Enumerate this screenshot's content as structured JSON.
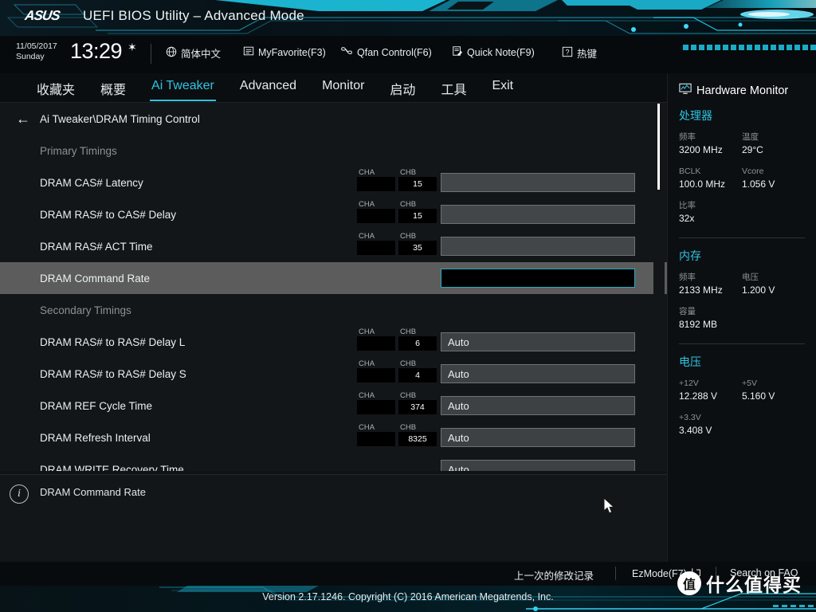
{
  "header": {
    "logo": "ASUS",
    "title": "UEFI BIOS Utility – Advanced Mode"
  },
  "infostrip": {
    "date": "11/05/2017",
    "weekday": "Sunday",
    "time": "13:29",
    "gear_icon": "gear-icon",
    "tools": [
      {
        "icon": "globe-icon",
        "label": "简体中文"
      },
      {
        "icon": "list-icon",
        "label": "MyFavorite(F3)"
      },
      {
        "icon": "fan-icon",
        "label": "Qfan Control(F6)"
      },
      {
        "icon": "note-icon",
        "label": "Quick Note(F9)"
      },
      {
        "icon": "question-icon",
        "label": "热键"
      }
    ]
  },
  "nav": {
    "tabs": [
      {
        "label": "收藏夹",
        "active": false
      },
      {
        "label": "概要",
        "active": false
      },
      {
        "label": "Ai Tweaker",
        "active": true
      },
      {
        "label": "Advanced",
        "active": false
      },
      {
        "label": "Monitor",
        "active": false
      },
      {
        "label": "启动",
        "active": false
      },
      {
        "label": "工具",
        "active": false
      },
      {
        "label": "Exit",
        "active": false
      }
    ]
  },
  "main": {
    "breadcrumb": "Ai Tweaker\\DRAM Timing Control",
    "back_icon": "back-arrow-icon",
    "ch_a_label": "CHA",
    "ch_b_label": "CHB",
    "rows": [
      {
        "kind": "group",
        "label": "Primary Timings"
      },
      {
        "kind": "item",
        "label": "DRAM CAS# Latency",
        "cha": "",
        "chb": "15",
        "value": "",
        "selected": false
      },
      {
        "kind": "item",
        "label": "DRAM RAS# to CAS# Delay",
        "cha": "",
        "chb": "15",
        "value": "",
        "selected": false
      },
      {
        "kind": "item",
        "label": "DRAM RAS# ACT Time",
        "cha": "",
        "chb": "35",
        "value": "",
        "selected": false
      },
      {
        "kind": "item",
        "label": "DRAM Command Rate",
        "cha": null,
        "chb": null,
        "value": "",
        "selected": true
      },
      {
        "kind": "group",
        "label": "Secondary Timings"
      },
      {
        "kind": "item",
        "label": "DRAM RAS# to RAS# Delay L",
        "cha": "",
        "chb": "6",
        "value": "Auto",
        "selected": false
      },
      {
        "kind": "item",
        "label": "DRAM RAS# to RAS# Delay S",
        "cha": "",
        "chb": "4",
        "value": "Auto",
        "selected": false
      },
      {
        "kind": "item",
        "label": "DRAM REF Cycle Time",
        "cha": "",
        "chb": "374",
        "value": "Auto",
        "selected": false
      },
      {
        "kind": "item",
        "label": "DRAM Refresh Interval",
        "cha": "",
        "chb": "8325",
        "value": "Auto",
        "selected": false
      },
      {
        "kind": "item",
        "label": "DRAM WRITE Recovery Time",
        "cha": null,
        "chb": null,
        "value": "Auto",
        "selected": false
      }
    ]
  },
  "help": {
    "icon": "info-icon",
    "text": "DRAM Command Rate"
  },
  "hardware_monitor": {
    "title": "Hardware Monitor",
    "title_icon": "monitor-icon",
    "sections": [
      {
        "name": "处理器",
        "entries": [
          {
            "key": "频率",
            "value": "3200 MHz"
          },
          {
            "key": "温度",
            "value": "29°C"
          },
          {
            "key": "BCLK",
            "value": "100.0 MHz"
          },
          {
            "key": "Vcore",
            "value": "1.056 V"
          },
          {
            "key": "比率",
            "value": "32x"
          }
        ]
      },
      {
        "name": "内存",
        "entries": [
          {
            "key": "频率",
            "value": "2133 MHz"
          },
          {
            "key": "电压",
            "value": "1.200 V"
          },
          {
            "key": "容量",
            "value": "8192 MB"
          }
        ]
      },
      {
        "name": "电压",
        "entries": [
          {
            "key": "+12V",
            "value": "12.288 V"
          },
          {
            "key": "+5V",
            "value": "5.160 V"
          },
          {
            "key": "+3.3V",
            "value": "3.408 V"
          }
        ]
      }
    ]
  },
  "bottombar": {
    "last_modified": "上一次的修改记录",
    "ezmode": "EzMode(F7)",
    "ezmode_icon": "ezmode-icon",
    "search_faq": "Search on FAQ"
  },
  "footer": {
    "version": "Version 2.17.1246. Copyright (C) 2016 American Megatrends, Inc."
  },
  "watermark": {
    "badge": "值",
    "text": "什么值得买"
  },
  "colors": {
    "accent": "#2fc4e0",
    "panel_bg": "#131618",
    "selected_row": "#5c5c5c",
    "field_bg": "#3e4143"
  }
}
